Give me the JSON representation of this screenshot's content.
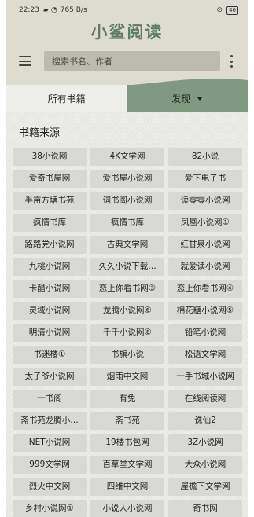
{
  "status_bar": {
    "time": "22:23",
    "signal_icon": "notification-icon",
    "wifi_icon": "wifi-icon",
    "network_speed": "765 B/s",
    "alarm_icon": "alarm-icon",
    "battery_level": "46"
  },
  "app": {
    "title": "小鲨阅读",
    "title_color": "#5e7e62"
  },
  "toolbar": {
    "menu_icon": "menu-icon",
    "search_placeholder": "搜索书名、作者",
    "more_icon": "more-vert-icon"
  },
  "tabs": [
    {
      "label": "所有书籍",
      "active": false
    },
    {
      "label": "发现",
      "active": true,
      "icon": "dropdown-arrow-icon"
    }
  ],
  "colors": {
    "header_bg": "#dedcd0",
    "tab_active_bg": "#7f9a80",
    "chip_bg": "#d8d8d4"
  },
  "sources": {
    "title": "书籍来源",
    "items": [
      "38小说网",
      "4K文学网",
      "82小说",
      "爱奇书屋网",
      "爱书屋小说网",
      "爱下电子书",
      "半亩方塘书苑",
      "词书阁小说网",
      "读零零小说网",
      "疯情书库",
      "疯情书库",
      "凤凰小说网①",
      "路路党小说网",
      "古典文学网",
      "红甘泉小说网",
      "九桃小说网",
      "久久小说下载…",
      "就爱读小说网",
      "卡醋小说网",
      "恋上你看书网③",
      "恋上你看书网④",
      "灵域小说网",
      "龙腾小说网⑥",
      "棉花糖小说网⑤",
      "明清小说网",
      "千千小说网⑧",
      "铅笔小说网",
      "书迷楼①",
      "书旗小说",
      "松语文学网",
      "太子爷小说网",
      "烟雨中文网",
      "一手书城小说网",
      "一书阁",
      "有免",
      "在线阅读网",
      "斋书苑龙腾小…",
      "斋书苑",
      "诛仙2",
      "NET小说网",
      "19楼书包网",
      "3Z小说网",
      "999文学网",
      "百草堂文学网",
      "大众小说网",
      "烈火中文网",
      "四维中文网",
      "屋檐下文学网",
      "乡村小说网①",
      "小说人小说网",
      "奇书网"
    ]
  }
}
